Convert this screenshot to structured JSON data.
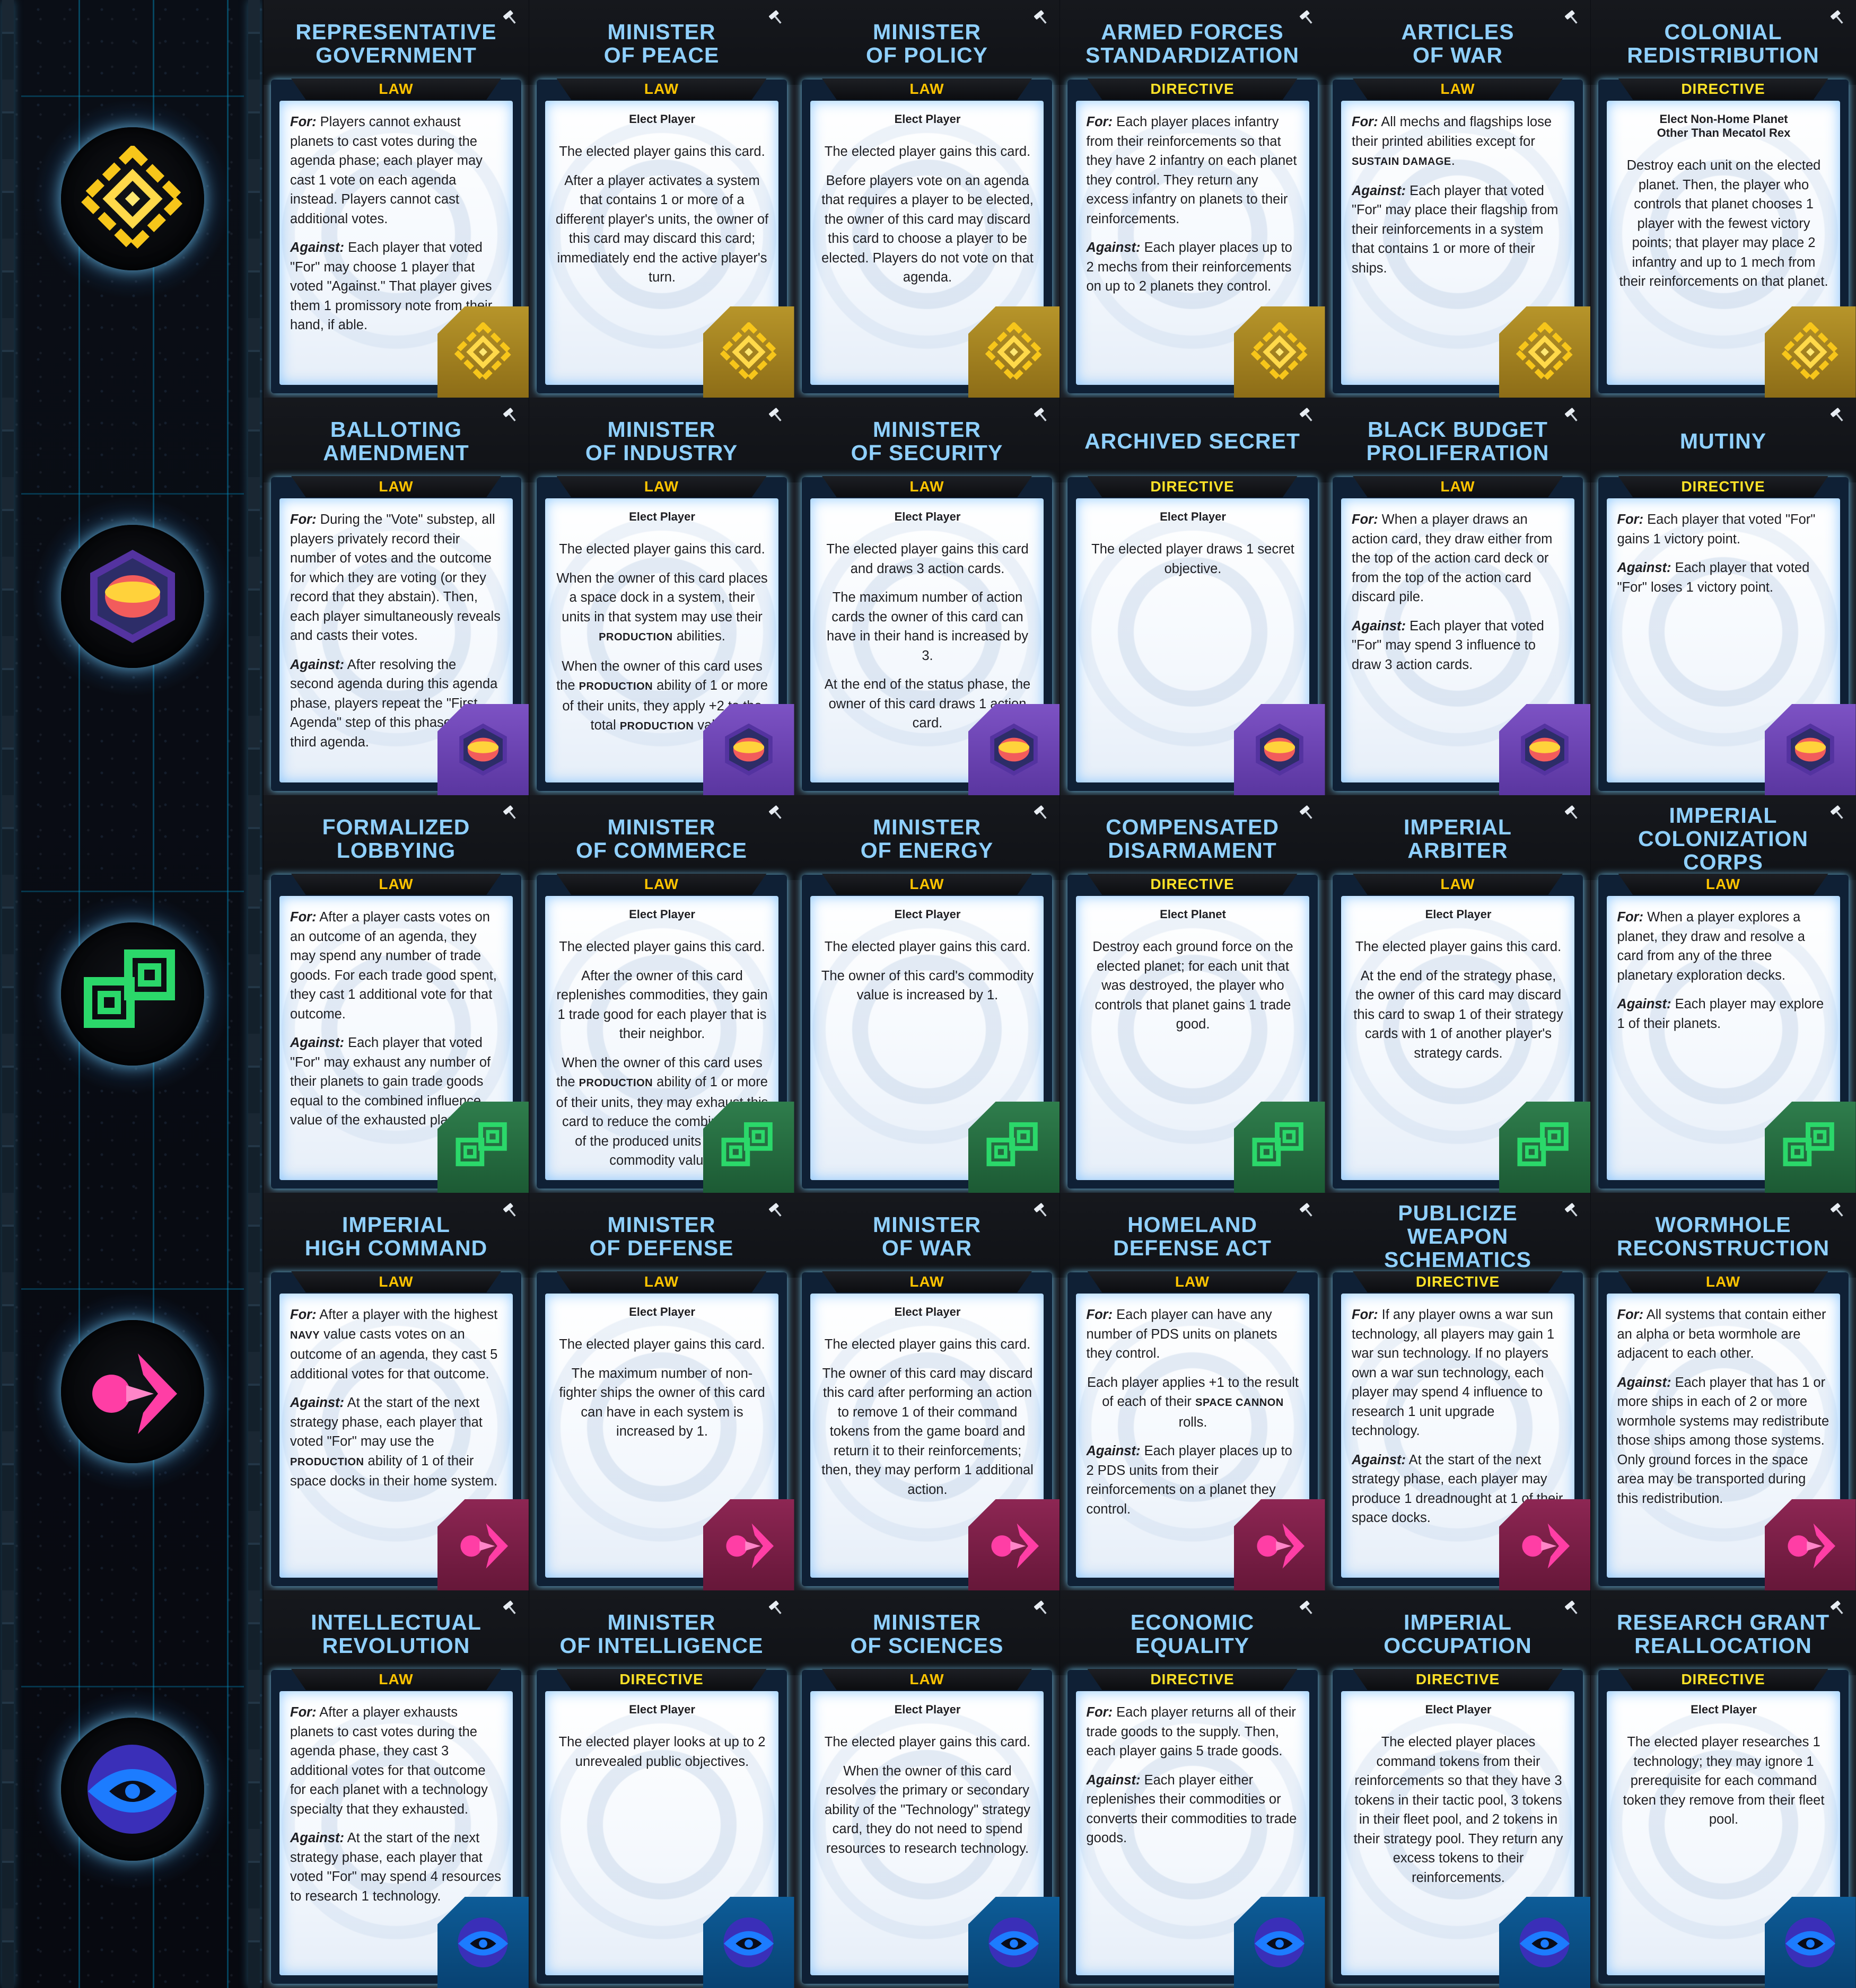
{
  "colors": {
    "title": "#8fd0ff",
    "law": "#ffc400",
    "directive": "#ffe227",
    "gold_faction": "#f7c61a",
    "purple_faction": "#6d3fb2",
    "green_faction": "#2bd86a",
    "pink_faction": "#ff3ea5",
    "blue_faction": "#1c7cff"
  },
  "strip": {
    "emblems": [
      {
        "icon": "gold-diamond-faction-icon"
      },
      {
        "icon": "purple-hexagon-eye-faction-icon"
      },
      {
        "icon": "green-linked-squares-faction-icon"
      },
      {
        "icon": "pink-arrow-faction-icon"
      },
      {
        "icon": "blue-eye-faction-icon"
      }
    ]
  },
  "cards": [
    {
      "title": "REPRESENTATIVE\nGOVERNMENT",
      "type": "LAW",
      "elect": "",
      "paras": [
        "For:| Players cannot exhaust planets to cast votes during the agenda phase; each player may cast 1 vote on each agenda instead. Players cannot cast additional votes.",
        "Against:| Each player that voted \"For\" may choose 1 player that voted \"Against.\" That player gives them 1 promissory note from their hand, if able."
      ],
      "badge": "gold-diamond-faction-icon"
    },
    {
      "title": "MINISTER\nOF PEACE",
      "type": "LAW",
      "elect": "Elect Player",
      "paras": [
        "|The elected player gains this card.",
        "|After a player activates a system that contains 1 or more of a different player's units, the owner of this card may discard this card; immediately end the active player's turn."
      ],
      "badge": "gold-diamond-faction-icon"
    },
    {
      "title": "MINISTER\nOF POLICY",
      "type": "LAW",
      "elect": "Elect Player",
      "paras": [
        "|The elected player gains this card.",
        "|Before players vote on an agenda that requires a player to be elected, the owner of this card may discard this card to choose a player to be elected. Players do not vote on that agenda."
      ],
      "badge": "gold-diamond-faction-icon"
    },
    {
      "title": "ARMED FORCES\nSTANDARDIZATION",
      "type": "DIRECTIVE",
      "elect": "",
      "paras": [
        "For:| Each player places infantry from their reinforcements so that they have 2 infantry on each planet they control. They return any excess infantry on planets to their reinforcements.",
        "Against:| Each player places up to 2 mechs from their reinforcements on up to 2 planets they control."
      ],
      "badge": "gold-diamond-faction-icon"
    },
    {
      "title": "ARTICLES\nOF WAR",
      "type": "LAW",
      "elect": "",
      "paras": [
        "For:| All mechs and flagships lose their printed abilities except for SUSTAIN DAMAGE.",
        "Against:| Each player that voted \"For\" may place their flagship from their reinforcements in a system that contains 1 or more of their ships."
      ],
      "badge": "gold-diamond-faction-icon"
    },
    {
      "title": "COLONIAL\nREDISTRIBUTION",
      "type": "DIRECTIVE",
      "elect": "Elect Non-Home Planet\nOther Than Mecatol Rex",
      "paras": [
        "|Destroy each unit on the elected planet. Then, the player who controls that planet chooses 1 player with the fewest victory points; that player may place 2 infantry and up to 1 mech from their reinforcements on that planet."
      ],
      "badge": "gold-diamond-faction-icon"
    },
    {
      "title": "BALLOTING\nAMENDMENT",
      "type": "LAW",
      "elect": "",
      "paras": [
        "For:| During the \"Vote\" substep, all players privately record their number of votes and the outcome for which they are voting (or they record that they abstain). Then, each player simultaneously reveals and casts their votes.",
        "Against:| After resolving the second agenda during this agenda phase, players repeat the \"First Agenda\" step of this phase for a third agenda."
      ],
      "badge": "purple-hexagon-eye-faction-icon"
    },
    {
      "title": "MINISTER\nOF INDUSTRY",
      "type": "LAW",
      "elect": "Elect Player",
      "paras": [
        "|The elected player gains this card.",
        "|When the owner of this card places a space dock in a system, their units in that system may use their PRODUCTION abilities.",
        "|When the owner of this card uses the PRODUCTION ability of 1 or more of their units, they apply +2 to the total PRODUCTION value."
      ],
      "badge": "purple-hexagon-eye-faction-icon"
    },
    {
      "title": "MINISTER\nOF SECURITY",
      "type": "LAW",
      "elect": "Elect Player",
      "paras": [
        "|The elected player gains this card and draws 3 action cards.",
        "|The maximum number of action cards the owner of this card can have in their hand is increased by 3.",
        "|At the end of the status phase, the owner of this card draws 1 action card."
      ],
      "badge": "purple-hexagon-eye-faction-icon"
    },
    {
      "title": "ARCHIVED SECRET",
      "type": "DIRECTIVE",
      "elect": "Elect Player",
      "paras": [
        "|The elected player draws 1 secret objective."
      ],
      "badge": "purple-hexagon-eye-faction-icon"
    },
    {
      "title": "BLACK BUDGET\nPROLIFERATION",
      "type": "LAW",
      "elect": "",
      "paras": [
        "For:| When a player draws an action card, they draw either from the top of the action card deck or from the top of the action card discard pile.",
        "Against:| Each player that voted \"For\" may spend 3 influence to draw 3 action cards."
      ],
      "badge": "purple-hexagon-eye-faction-icon"
    },
    {
      "title": "MUTINY",
      "type": "DIRECTIVE",
      "elect": "",
      "paras": [
        "For:| Each player that voted \"For\" gains 1 victory point.",
        "Against:| Each player that voted \"For\" loses 1 victory point."
      ],
      "badge": "purple-hexagon-eye-faction-icon"
    },
    {
      "title": "FORMALIZED\nLOBBYING",
      "type": "LAW",
      "elect": "",
      "paras": [
        "For:| After a player casts votes on an outcome of an agenda, they may spend any number of trade goods. For each trade good spent, they cast 1 additional vote for that outcome.",
        "Against:| Each player that voted \"For\" may exhaust any number of their planets to gain trade goods equal to the combined influence value of the exhausted planets."
      ],
      "badge": "green-linked-squares-faction-icon"
    },
    {
      "title": "MINISTER\nOF COMMERCE",
      "type": "LAW",
      "elect": "Elect Player",
      "paras": [
        "|The elected player gains this card.",
        "|After the owner of this card replenishes commodities, they gain 1 trade good for each player that is their neighbor.",
        "|When the owner of this card uses the PRODUCTION ability of 1 or more of their units, they may exhaust this card to reduce the combined cost of the produced units by their commodity value."
      ],
      "badge": "green-linked-squares-faction-icon"
    },
    {
      "title": "MINISTER\nOF ENERGY",
      "type": "LAW",
      "elect": "Elect Player",
      "paras": [
        "|The elected player gains this card.",
        "|The owner of this card's commodity value is increased by 1."
      ],
      "badge": "green-linked-squares-faction-icon"
    },
    {
      "title": "COMPENSATED\nDISARMAMENT",
      "type": "DIRECTIVE",
      "elect": "Elect Planet",
      "paras": [
        "|Destroy each ground force on the elected planet; for each unit that was destroyed, the player who controls that planet gains 1 trade good."
      ],
      "badge": "green-linked-squares-faction-icon"
    },
    {
      "title": "IMPERIAL\nARBITER",
      "type": "LAW",
      "elect": "Elect Player",
      "paras": [
        "|The elected player gains this card.",
        "|At the end of the strategy phase, the owner of this card may discard this card to swap 1 of their strategy cards with 1 of another player's strategy cards."
      ],
      "badge": "green-linked-squares-faction-icon"
    },
    {
      "title": "IMPERIAL\nCOLONIZATION\nCORPS",
      "type": "LAW",
      "elect": "",
      "paras": [
        "For:| When a player explores a planet, they draw and resolve a card from any of the three planetary exploration decks.",
        "Against:| Each player may explore 1 of their planets."
      ],
      "badge": "green-linked-squares-faction-icon"
    },
    {
      "title": "IMPERIAL\nHIGH COMMAND",
      "type": "LAW",
      "elect": "",
      "paras": [
        "For:| After a player with the highest NAVY value casts votes on an outcome of an agenda, they cast 5 additional votes for that outcome.",
        "Against:| At the start of the next strategy phase, each player that voted \"For\" may use the PRODUCTION ability of 1 of their space docks in their home system."
      ],
      "badge": "pink-arrow-faction-icon"
    },
    {
      "title": "MINISTER\nOF DEFENSE",
      "type": "LAW",
      "elect": "Elect Player",
      "paras": [
        "|The elected player gains this card.",
        "|The maximum number of non-fighter ships the owner of this card can have in each system is increased by 1."
      ],
      "badge": "pink-arrow-faction-icon"
    },
    {
      "title": "MINISTER\nOF WAR",
      "type": "LAW",
      "elect": "Elect Player",
      "paras": [
        "|The elected player gains this card.",
        "|The owner of this card may discard this card after performing an action to remove 1 of their command tokens from the game board and return it to their reinforcements; then, they may perform 1 additional action."
      ],
      "badge": "pink-arrow-faction-icon"
    },
    {
      "title": "HOMELAND\nDEFENSE ACT",
      "type": "LAW",
      "elect": "",
      "paras": [
        "For:| Each player can have any number of PDS units on planets they control.",
        "| Each player applies +1 to the result of each of their SPACE CANNON rolls.",
        "Against:| Each player places up to 2 PDS units from their reinforcements on a planet they control."
      ],
      "badge": "pink-arrow-faction-icon"
    },
    {
      "title": "PUBLICIZE\nWEAPON\nSCHEMATICS",
      "type": "DIRECTIVE",
      "elect": "",
      "paras": [
        "For:| If any player owns a war sun technology, all players may gain 1 war sun technology. If no players own a war sun technology, each player may spend 4 influence to research 1 unit upgrade technology.",
        "Against:| At the start of the next strategy phase, each player may produce 1 dreadnought at 1 of their space docks."
      ],
      "badge": "pink-arrow-faction-icon"
    },
    {
      "title": "WORMHOLE\nRECONSTRUCTION",
      "type": "LAW",
      "elect": "",
      "paras": [
        "For:| All systems that contain either an alpha or beta wormhole are adjacent to each other.",
        "Against:| Each player that has 1 or more ships in each of 2 or more wormhole systems may redistribute those ships among those systems. Only ground forces in the space area may be transported during this redistribution."
      ],
      "badge": "pink-arrow-faction-icon"
    },
    {
      "title": "INTELLECTUAL\nREVOLUTION",
      "type": "LAW",
      "elect": "",
      "paras": [
        "For:| After a player exhausts planets to cast votes during the agenda phase, they cast 3 additional votes for that outcome for each planet with a technology specialty that they exhausted.",
        "Against:| At the start of the next strategy phase, each player that voted \"For\" may spend 4 resources to research 1 technology."
      ],
      "badge": "blue-eye-faction-icon"
    },
    {
      "title": "MINISTER\nOF INTELLIGENCE",
      "type": "DIRECTIVE",
      "elect": "Elect Player",
      "paras": [
        "|The elected player looks at up to 2 unrevealed public objectives."
      ],
      "badge": "blue-eye-faction-icon"
    },
    {
      "title": "MINISTER\nOF SCIENCES",
      "type": "LAW",
      "elect": "Elect Player",
      "paras": [
        "|The elected player gains this card.",
        "|When the owner of this card resolves the primary or secondary ability of the \"Technology\" strategy card, they do not need to spend resources to research technology."
      ],
      "badge": "blue-eye-faction-icon"
    },
    {
      "title": "ECONOMIC\nEQUALITY",
      "type": "DIRECTIVE",
      "elect": "",
      "paras": [
        "For:| Each player returns all of their trade goods to the supply. Then, each player gains 5 trade goods.",
        "Against:| Each player either replenishes their commodities or converts their commodities to trade goods."
      ],
      "badge": "blue-eye-faction-icon"
    },
    {
      "title": "IMPERIAL\nOCCUPATION",
      "type": "DIRECTIVE",
      "elect": "Elect Player",
      "paras": [
        "|The elected player places command tokens from their reinforcements so that they have 3 tokens in their tactic pool, 3 tokens in their fleet pool, and 2 tokens in their strategy pool. They return any excess tokens to their reinforcements."
      ],
      "badge": "blue-eye-faction-icon"
    },
    {
      "title": "RESEARCH GRANT\nREALLOCATION",
      "type": "DIRECTIVE",
      "elect": "Elect Player",
      "paras": [
        "|The elected player researches 1 technology; they may ignore 1 prerequisite for each command token they remove from their fleet pool."
      ],
      "badge": "blue-eye-faction-icon"
    }
  ]
}
